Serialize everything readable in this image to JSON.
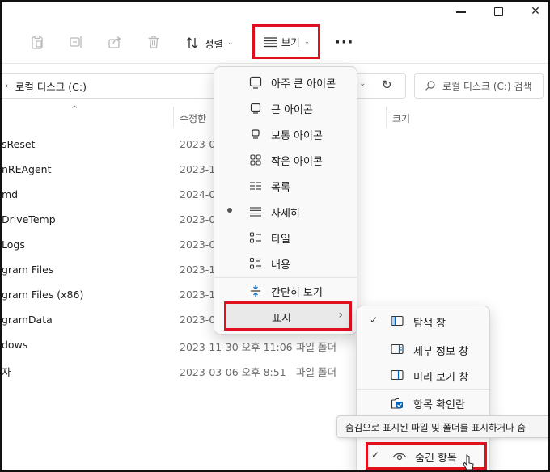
{
  "window": {
    "controls": [
      "minimize-icon",
      "maximize-icon",
      "close-icon"
    ],
    "close_glyph": "✕"
  },
  "toolbar": {
    "sort_label": "정렬",
    "view_label": "보기",
    "more_label": "···",
    "chevron": "⌄"
  },
  "address": {
    "path_label": "로컬 디스크 (C:)",
    "search_placeholder": "로컬 디스크 (C:) 검색",
    "refresh_glyph": "↻"
  },
  "columns": {
    "modified": "수정한",
    "size": "크기"
  },
  "rows": [
    {
      "name": "sReset",
      "date": "2023-0",
      "type": ""
    },
    {
      "name": "nREAgent",
      "date": "2023-1",
      "type": ""
    },
    {
      "name": "md",
      "date": "2024-0",
      "type": ""
    },
    {
      "name": "DriveTemp",
      "date": "2023-0",
      "type": ""
    },
    {
      "name": "Logs",
      "date": "2023-0",
      "type": ""
    },
    {
      "name": "gram Files",
      "date": "2023-1",
      "type": ""
    },
    {
      "name": "gram Files (x86)",
      "date": "2023-1",
      "type": ""
    },
    {
      "name": "gramData",
      "date": "2023-0",
      "type": ""
    },
    {
      "name": "dows",
      "date": "2023-11-30 오후 11:06",
      "type": "파일 폴더"
    },
    {
      "name": "자",
      "date": "2023-03-06 오후 8:51",
      "type": "파일 폴더"
    }
  ],
  "view_menu": {
    "items": [
      {
        "label": "아주 큰 아이콘",
        "icon": "extra-large-icons-icon"
      },
      {
        "label": "큰 아이콘",
        "icon": "large-icons-icon"
      },
      {
        "label": "보통 아이콘",
        "icon": "medium-icons-icon"
      },
      {
        "label": "작은 아이콘",
        "icon": "small-icons-icon"
      },
      {
        "label": "목록",
        "icon": "list-icon"
      },
      {
        "label": "자세히",
        "icon": "details-icon",
        "selected": true
      },
      {
        "label": "타일",
        "icon": "tiles-icon"
      },
      {
        "label": "내용",
        "icon": "content-icon"
      }
    ],
    "compact_label": "간단히 보기",
    "show_label": "표시",
    "show_arrow": "›"
  },
  "show_menu": {
    "items": [
      {
        "label": "탐색 창",
        "checked": true
      },
      {
        "label": "세부 정보 창",
        "checked": false
      },
      {
        "label": "미리 보기 창",
        "checked": false
      }
    ],
    "checkbox_label": "항목 확인란",
    "hidden_label": "숨긴 항목",
    "check_glyph": "✓"
  },
  "tooltip": {
    "text": "숨김으로 표시된 파일 및 폴더를 표시하거나 숨"
  },
  "colors": {
    "highlight_border": "#e0101c",
    "menu_bg": "#f9f9f9",
    "accent": "#0067c0"
  }
}
